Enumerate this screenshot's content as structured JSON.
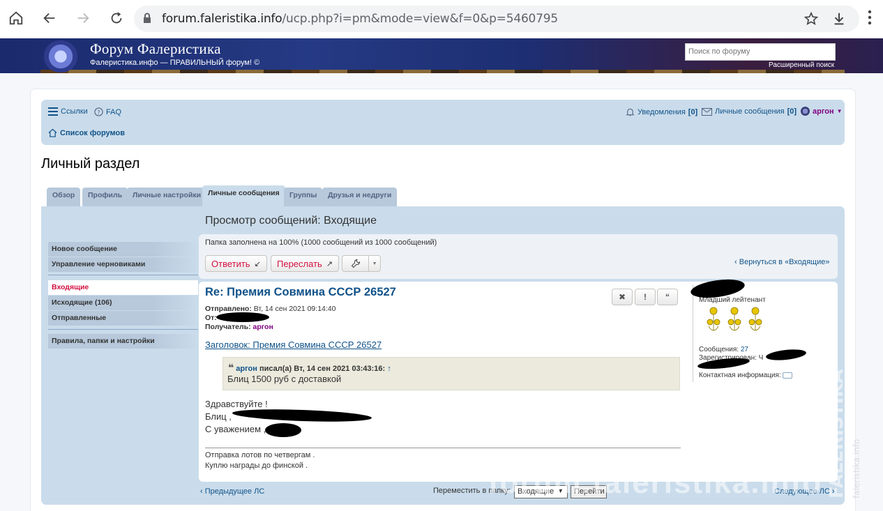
{
  "browser": {
    "url_domain": "forum.faleristika.info",
    "url_path": "/ucp.php?i=pm&mode=view&f=0&p=5460795"
  },
  "header": {
    "title": "Форум Фалеристика",
    "description": "Фалеристика.инфо — ПРАВИЛЬНЫЙ форум! ©",
    "search_placeholder": "Поиск по форуму",
    "advanced_search": "Расширенный поиск"
  },
  "navbar": {
    "links": "Ссылки",
    "faq": "FAQ",
    "notifications": "Уведомления",
    "notifications_count": "[0]",
    "pm": "Личные сообщения",
    "pm_count": "[0]",
    "username": "аргон",
    "forum_index": "Список форумов"
  },
  "page": {
    "title": "Личный раздел"
  },
  "tabs": [
    {
      "label": "Обзор"
    },
    {
      "label": "Профиль"
    },
    {
      "label": "Личные настройки"
    },
    {
      "label": "Личные сообщения"
    },
    {
      "label": "Группы"
    },
    {
      "label": "Друзья и недруги"
    }
  ],
  "sidebar": {
    "items": [
      {
        "label": "Новое сообщение"
      },
      {
        "label": "Управление черновиками"
      },
      {
        "label": "Входящие"
      },
      {
        "label": "Исходящие (106)"
      },
      {
        "label": "Отправленные"
      },
      {
        "label": "Правила, папки и настройки"
      }
    ]
  },
  "content": {
    "title": "Просмотр сообщений: Входящие",
    "folder_status": "Папка заполнена на 100% (1000 сообщений из 1000 сообщений)",
    "reply_button": "Ответить",
    "forward_button": "Переслать",
    "back_link": "Вернуться в «Входящие»"
  },
  "message": {
    "title": "Re: Премия Совмина СССР 26527",
    "sent_label": "Отправлено:",
    "sent_value": "Вт, 14 сен 2021 09:14:40",
    "from_label": "От:",
    "to_label": "Получатель:",
    "to_value": "аргон",
    "subject_link": "Заголовок: Премия Совмина СССР 26527",
    "quote_user": "аргон",
    "quote_wrote": "писал(а) Вт, 14 сен 2021 03:43:16:",
    "quote_body": "Блиц 1500 руб с доставкой",
    "body_lines": [
      "Здравствуйте !",
      "Блиц ,",
      "С уважением ,"
    ],
    "signature": [
      "Отправка лотов по четвергам .",
      "Куплю награды до финской ."
    ]
  },
  "profile": {
    "rank": "Младший лейтенант",
    "posts_label": "Сообщения:",
    "posts_value": "27",
    "registered_label": "Зарегистрирован:",
    "registered_value": "Ч",
    "contact_label": "Контактная информация:"
  },
  "footer": {
    "prev": "Предыдущее ЛС",
    "next": "Следующее ЛС",
    "move_label": "Переместить в папку:",
    "move_select": "Входящие",
    "go_button": "Перейти"
  },
  "watermark": "forum.faleristika.info",
  "colors": {
    "link": "#105289",
    "accent_red": "#d31141",
    "panel_bg": "#cadceb",
    "username": "#800080"
  }
}
